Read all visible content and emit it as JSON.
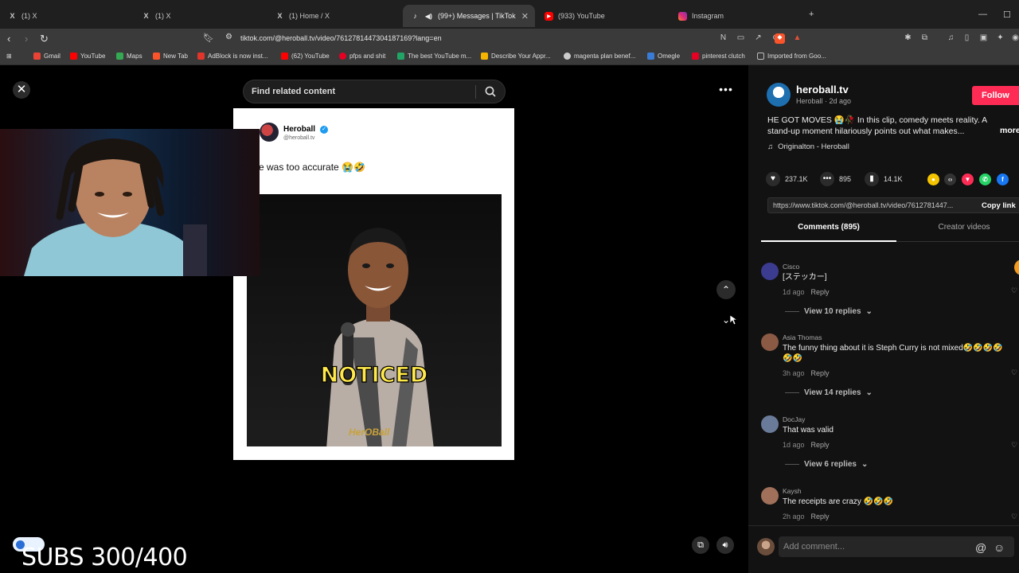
{
  "browser": {
    "tabs": [
      {
        "label": "(1) X",
        "icon": "x-logo-icon"
      },
      {
        "label": "(1) X",
        "icon": "x-logo-icon"
      },
      {
        "label": "(1) Home / X",
        "icon": "x-logo-icon"
      },
      {
        "label": "(99+) Messages | TikTok",
        "icon": "tiktok-icon"
      },
      {
        "label": "(933) YouTube",
        "icon": "youtube-icon"
      },
      {
        "label": "Instagram",
        "icon": "instagram-icon"
      }
    ],
    "url": "tiktok.com/@heroball.tv/video/7612781447304187169?lang=en",
    "bookmarks": [
      {
        "label": "Gmail",
        "color": "#ea4335"
      },
      {
        "label": "YouTube",
        "color": "#ff0000"
      },
      {
        "label": "Maps",
        "color": "#34a853"
      },
      {
        "label": "New Tab",
        "color": "#fb542b"
      },
      {
        "label": "AdBlock is now inst...",
        "color": "#e0352b"
      },
      {
        "label": "(62) YouTube",
        "color": "#ff0000"
      },
      {
        "label": "pfps and shit",
        "color": "#e60023"
      },
      {
        "label": "The best YouTube m...",
        "color": "#21a366"
      },
      {
        "label": "Describe Your Appr...",
        "color": "#f5b400"
      },
      {
        "label": "magenta plan benef...",
        "color": "#cccccc"
      },
      {
        "label": "Omegle",
        "color": "#3a7bd5"
      },
      {
        "label": "pinterest clutch",
        "color": "#e60023"
      },
      {
        "label": "Imported from Goo...",
        "color": "#999999"
      }
    ]
  },
  "stage": {
    "search_placeholder": "Find related content",
    "tweet": {
      "name": "Heroball",
      "handle": "@heroball.tv",
      "text": "e was too accurate 😭🤣"
    },
    "caption_overlay": "NOTICED",
    "watermark": "HerOBall",
    "subs_counter": "SUBS 300/400"
  },
  "panel": {
    "author": {
      "name": "heroball.tv",
      "meta": "Heroball · 2d ago",
      "follow_label": "Follow"
    },
    "caption": "HE GOT MOVES 😭🥀 In this clip, comedy meets reality. A stand-up moment hilariously points out what makes...",
    "caption_more": "more",
    "sound": "Originalton - Heroball",
    "stats": {
      "likes": "237.1K",
      "comments": "895",
      "saves": "14.1K"
    },
    "link": "https://www.tiktok.com/@heroball.tv/video/7612781447...",
    "copy_link": "Copy link",
    "tabs": {
      "comments": "Comments (895)",
      "creator": "Creator videos"
    },
    "comments": [
      {
        "user": "Cisco",
        "text": "[ステッカー]",
        "time": "1d ago",
        "reply": "Reply",
        "replies": "View 10 replies",
        "avatar_color": "#3b3b8f"
      },
      {
        "user": "Asia Thomas",
        "text": "The funny thing about it is Steph Curry is not mixed🤣🤣🤣🤣🤣🤣",
        "time": "3h ago",
        "reply": "Reply",
        "replies": "View 14 replies",
        "avatar_color": "#8a5a44"
      },
      {
        "user": "DocJay",
        "text": "That was valid",
        "time": "1d ago",
        "reply": "Reply",
        "replies": "View 6 replies",
        "avatar_color": "#6a7b9a"
      },
      {
        "user": "Kaysh",
        "text": "The receipts are crazy 🤣🤣🤣",
        "time": "2h ago",
        "reply": "Reply",
        "replies": "",
        "avatar_color": "#a0705a"
      }
    ],
    "add_comment_placeholder": "Add comment..."
  },
  "colors": {
    "accent": "#fe2c55",
    "panel_bg": "#121212",
    "caption_yellow": "#ffe84a"
  }
}
